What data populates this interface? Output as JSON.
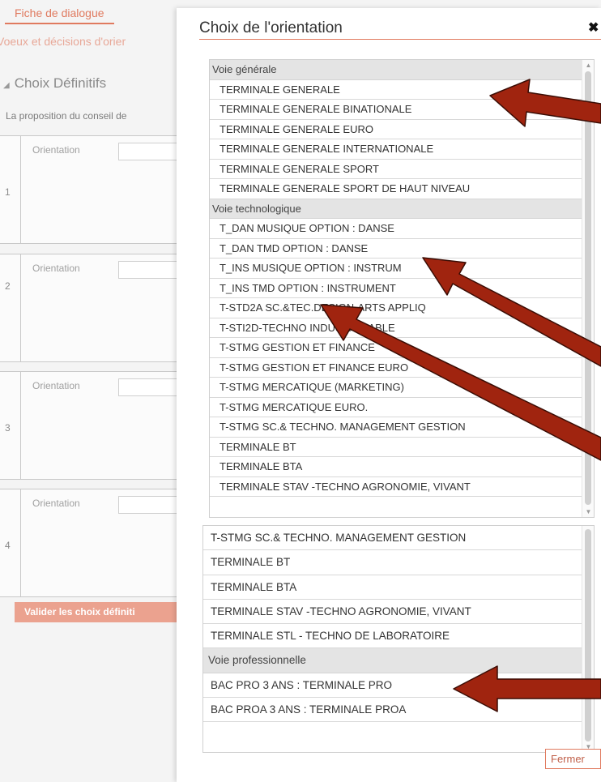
{
  "background": {
    "tab_label": "Fiche de dialogue",
    "subtitle": "Voeux et décisions d'orier",
    "section_title": "Choix Définitifs",
    "proposition_text": "La proposition du conseil de",
    "rows": [
      {
        "number": "1",
        "label": "Orientation"
      },
      {
        "number": "2",
        "label": "Orientation"
      },
      {
        "number": "3",
        "label": "Orientation"
      },
      {
        "number": "4",
        "label": "Orientation"
      }
    ],
    "validate_button": "Valider les choix définiti"
  },
  "modal": {
    "title": "Choix de l'orientation",
    "close_icon": "close-icon",
    "close_button": "Fermer",
    "top_list": {
      "groups": [
        {
          "label": "Voie générale",
          "options": [
            "TERMINALE GENERALE",
            "TERMINALE GENERALE BINATIONALE",
            "TERMINALE GENERALE EURO",
            "TERMINALE GENERALE INTERNATIONALE",
            "TERMINALE GENERALE SPORT",
            "TERMINALE GENERALE SPORT DE HAUT NIVEAU"
          ]
        },
        {
          "label": "Voie technologique",
          "options": [
            "T_DAN MUSIQUE OPTION : DANSE",
            "T_DAN TMD OPTION : DANSE",
            "T_INS MUSIQUE OPTION : INSTRUM",
            "T_INS TMD OPTION : INSTRUMENT",
            "T-STD2A SC.&TEC.DESIGN-ARTS APPLIQ",
            "T-STI2D-TECHNO INDUS.DURABLE",
            "T-STMG GESTION ET FINANCE",
            "T-STMG GESTION ET FINANCE EURO",
            "T-STMG MERCATIQUE (MARKETING)",
            "T-STMG MERCATIQUE EURO.",
            "T-STMG SC.& TECHNO. MANAGEMENT GESTION",
            "TERMINALE BT",
            "TERMINALE BTA",
            "TERMINALE STAV -TECHNO AGRONOMIE, VIVANT"
          ]
        }
      ]
    },
    "bottom_list": {
      "options_before": [
        "T-STMG SC.& TECHNO. MANAGEMENT GESTION",
        "TERMINALE BT",
        "TERMINALE BTA",
        "TERMINALE STAV -TECHNO AGRONOMIE, VIVANT",
        "TERMINALE STL - TECHNO DE LABORATOIRE"
      ],
      "group_label": "Voie professionnelle",
      "options_after": [
        "BAC PRO 3 ANS : TERMINALE PRO",
        "BAC PROA 3 ANS : TERMINALE PROA"
      ]
    }
  },
  "colors": {
    "accent": "#e07a5f",
    "arrow": "#a0240f",
    "group_bg": "#e4e4e4"
  }
}
